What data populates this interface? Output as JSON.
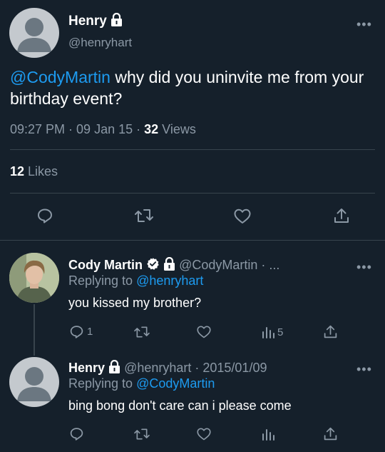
{
  "main_tweet": {
    "author_name": "Henry",
    "handle": "@henryhart",
    "mention": "@CodyMartin",
    "text": " why did you uninvite me from your birthday event?",
    "time": "09:27 PM · 09 Jan 15 · ",
    "views_count": "32",
    "views_label": " Views",
    "likes_count": "12",
    "likes_label": " Likes"
  },
  "reply1": {
    "author_name": "Cody Martin",
    "handle": "@CodyMartin · ...",
    "replying_prefix": "Replying to ",
    "replying_to": "@henryhart",
    "text": "you kissed my brother?",
    "reply_count": "1",
    "views_count": "5"
  },
  "reply2": {
    "author_name": "Henry",
    "handle": "@henryhart · 2015/01/09",
    "replying_prefix": "Replying to ",
    "replying_to": "@CodyMartin",
    "text": "bing bong don't care can i please come"
  },
  "more_glyph": "•••",
  "colors": {
    "background": "#15202b",
    "link": "#1d9bf0",
    "muted": "#8b98a5",
    "divider": "#38444d"
  },
  "icons": [
    "lock-icon",
    "verified-icon",
    "reply-icon",
    "retweet-icon",
    "like-icon",
    "share-icon",
    "views-icon",
    "more-icon"
  ]
}
